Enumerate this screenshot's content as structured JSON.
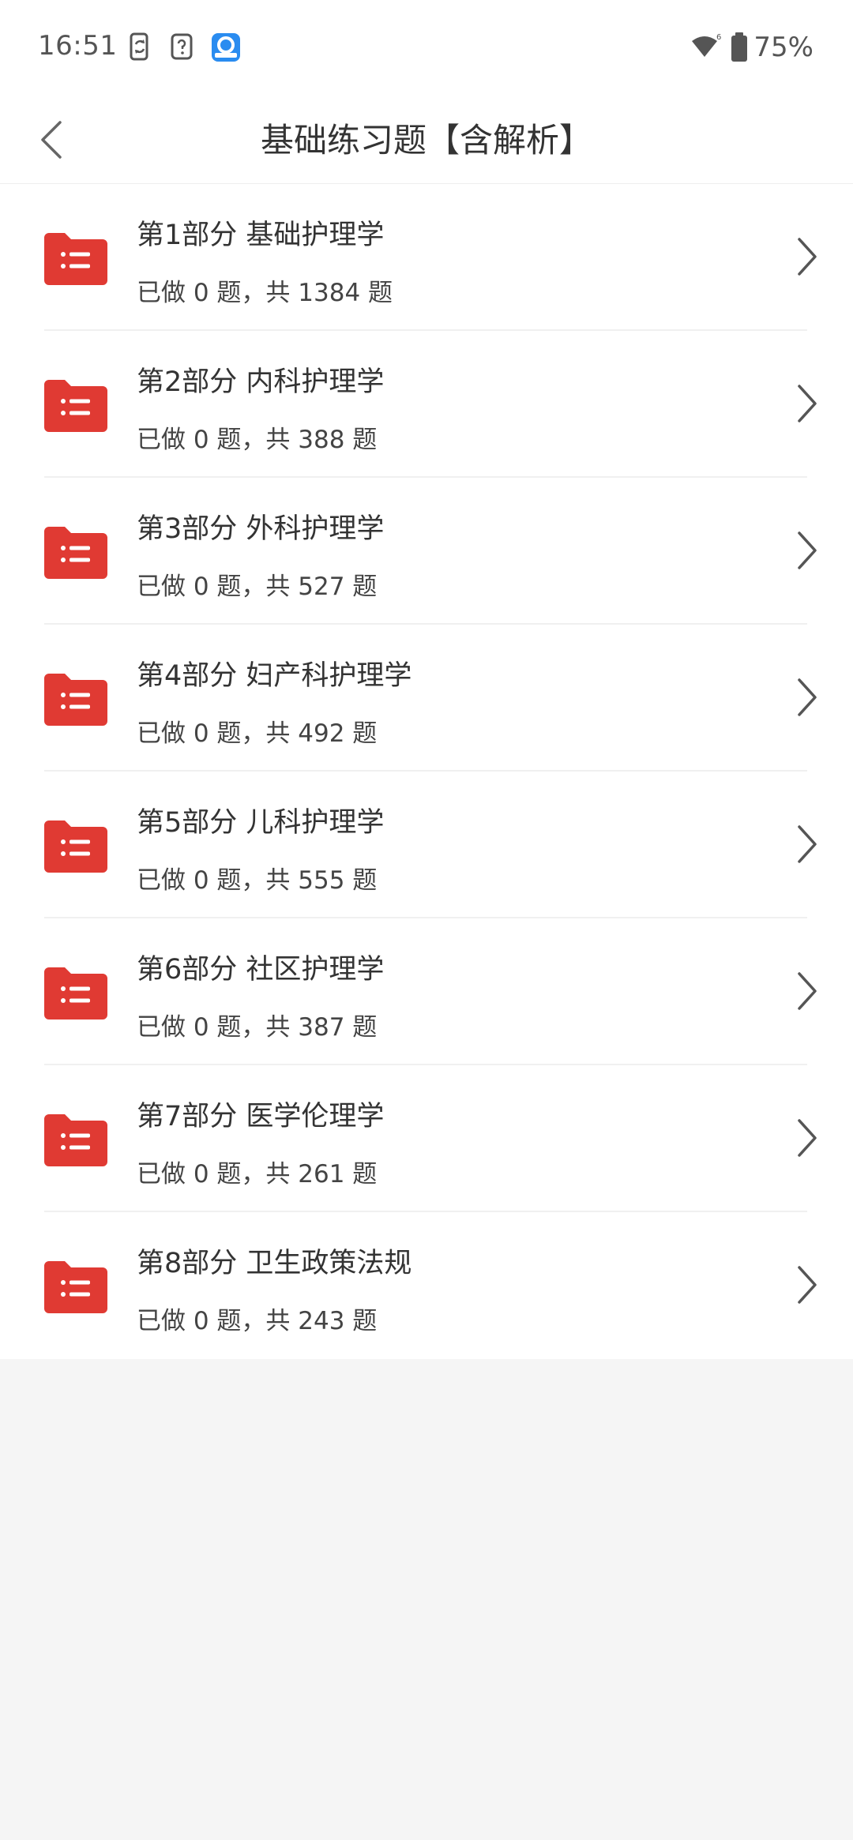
{
  "status_bar": {
    "time": "16:51",
    "left_icons": [
      "phone-sync-icon",
      "help-doc-icon",
      "app-cloud-icon"
    ],
    "right_icons": [
      "wifi-signal-icon",
      "battery-icon"
    ],
    "battery": "75%"
  },
  "nav": {
    "back_icon": "chevron-left-icon",
    "title": "基础练习题【含解析】"
  },
  "theme": {
    "accent": "#e03a33",
    "background": "#f5f5f5",
    "text": "#333333"
  },
  "sections": [
    {
      "title": "第1部分 基础护理学",
      "subtitle": "已做 0 题，共 1384 题"
    },
    {
      "title": "第2部分 内科护理学",
      "subtitle": "已做 0 题，共 388 题"
    },
    {
      "title": "第3部分 外科护理学",
      "subtitle": "已做 0 题，共 527 题"
    },
    {
      "title": "第4部分 妇产科护理学",
      "subtitle": "已做 0 题，共 492 题"
    },
    {
      "title": "第5部分 儿科护理学",
      "subtitle": "已做 0 题，共 555 题"
    },
    {
      "title": "第6部分 社区护理学",
      "subtitle": "已做 0 题，共 387 题"
    },
    {
      "title": "第7部分 医学伦理学",
      "subtitle": "已做 0 题，共 261 题"
    },
    {
      "title": "第8部分 卫生政策法规",
      "subtitle": "已做 0 题，共 243 题"
    }
  ]
}
